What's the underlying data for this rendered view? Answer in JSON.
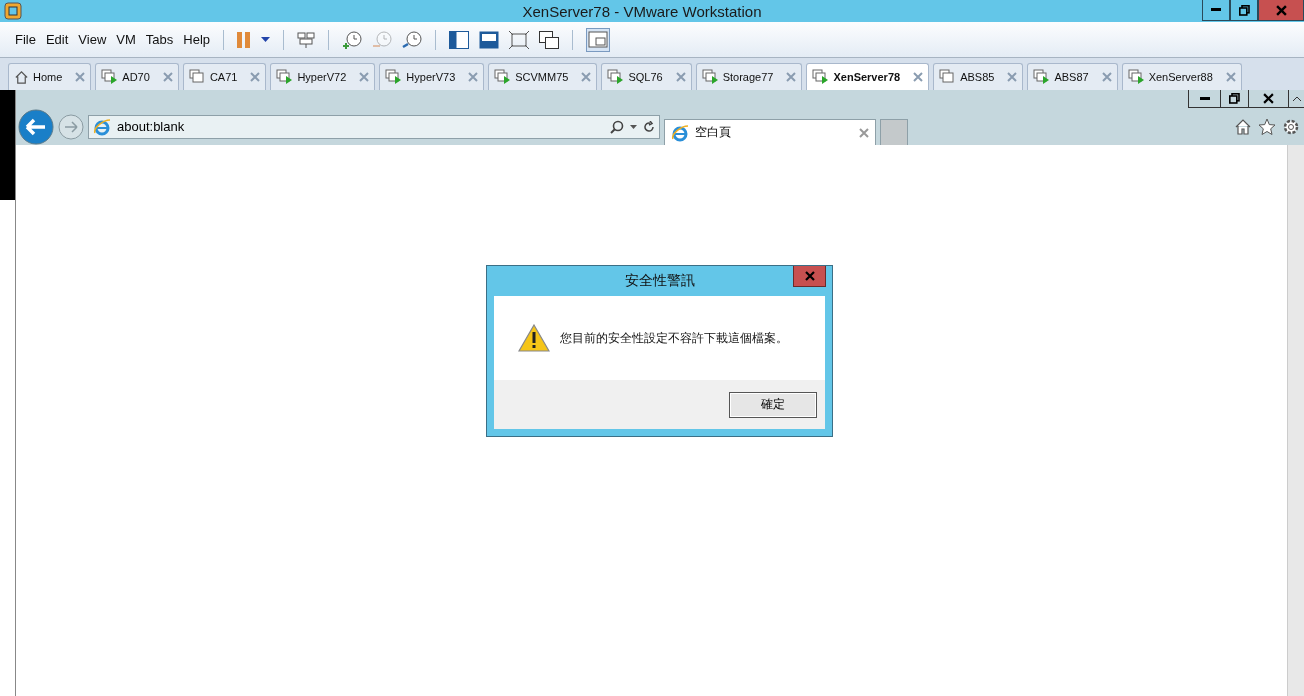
{
  "window": {
    "title": "XenServer78 - VMware Workstation"
  },
  "menu": [
    "File",
    "Edit",
    "View",
    "VM",
    "Tabs",
    "Help"
  ],
  "tabs": [
    {
      "label": "Home",
      "kind": "home",
      "selected": false
    },
    {
      "label": "AD70",
      "kind": "vm",
      "selected": false
    },
    {
      "label": "CA71",
      "kind": "vm-off",
      "selected": false
    },
    {
      "label": "HyperV72",
      "kind": "vm",
      "selected": false
    },
    {
      "label": "HyperV73",
      "kind": "vm",
      "selected": false
    },
    {
      "label": "SCVMM75",
      "kind": "vm",
      "selected": false
    },
    {
      "label": "SQL76",
      "kind": "vm",
      "selected": false
    },
    {
      "label": "Storage77",
      "kind": "vm",
      "selected": false
    },
    {
      "label": "XenServer78",
      "kind": "vm",
      "selected": true
    },
    {
      "label": "ABS85",
      "kind": "vm-off",
      "selected": false
    },
    {
      "label": "ABS87",
      "kind": "vm",
      "selected": false
    },
    {
      "label": "XenServer88",
      "kind": "vm",
      "selected": false
    }
  ],
  "browser": {
    "address": "about:blank",
    "tab_title": "空白頁"
  },
  "dialog": {
    "title": "安全性警訊",
    "message": "您目前的安全性設定不容許下載這個檔案。",
    "button": "確定"
  }
}
